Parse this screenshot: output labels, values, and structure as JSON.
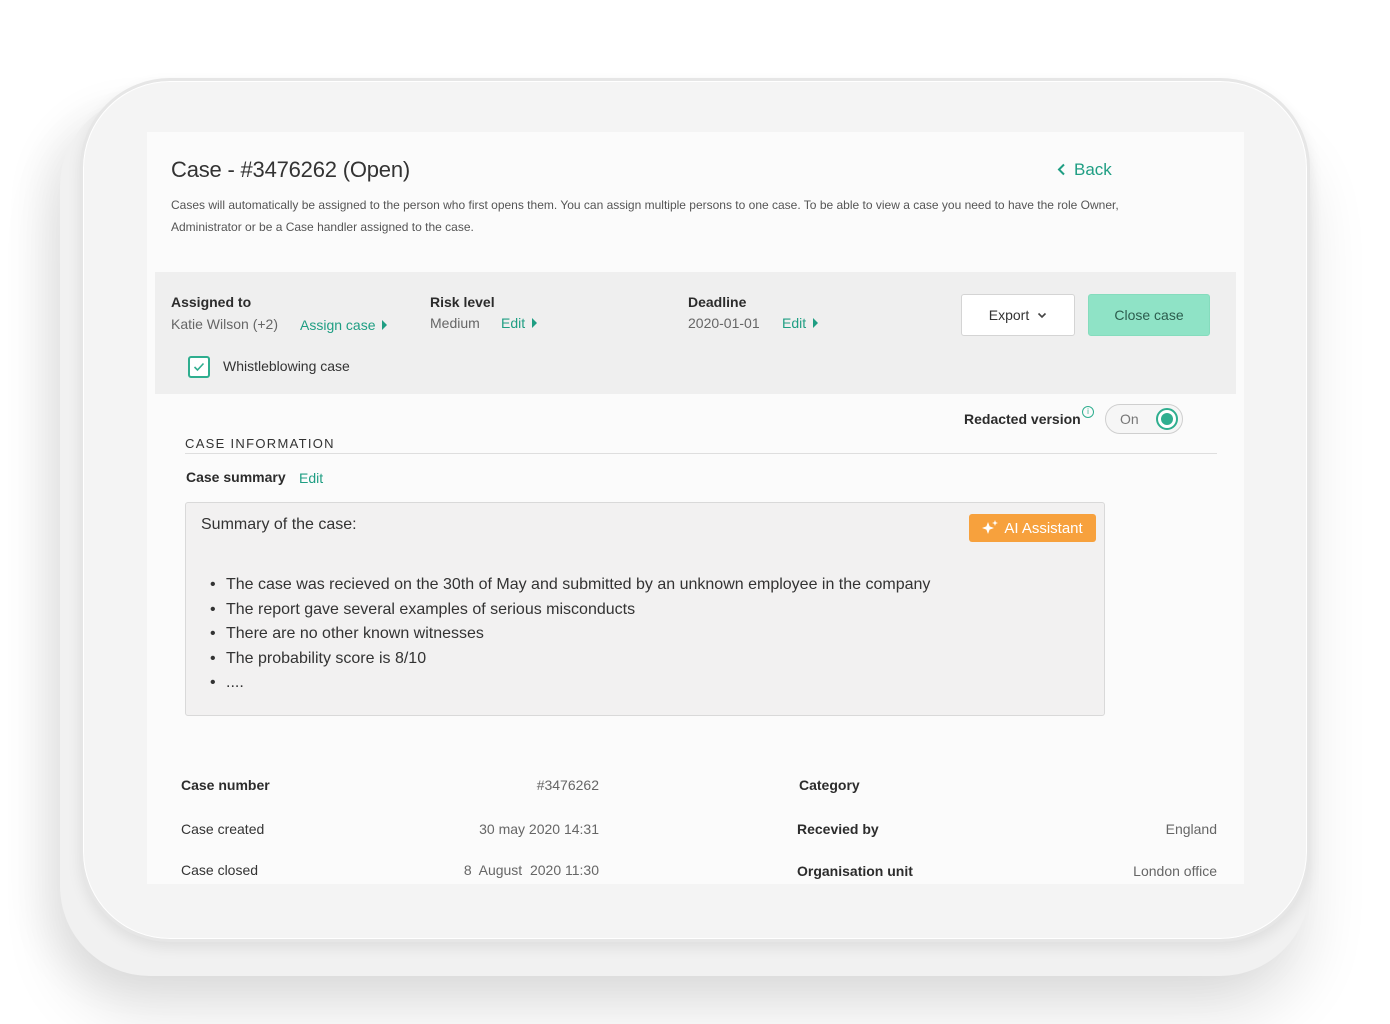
{
  "header": {
    "title": "Case - #3476262 (Open)",
    "back_label": "Back",
    "description": "Cases will automatically be assigned to the person who first opens them. You can assign multiple persons to one case. To be able to view a case you need to have the role Owner, Administrator or be a Case handler assigned to the case."
  },
  "bar": {
    "assigned_label": "Assigned to",
    "assigned_value": "Katie Wilson (+2)",
    "assign_link": "Assign case",
    "risk_label": "Risk level",
    "risk_value": "Medium",
    "risk_edit": "Edit",
    "deadline_label": "Deadline",
    "deadline_value": "2020-01-01",
    "deadline_edit": "Edit",
    "export_label": "Export",
    "close_label": "Close case",
    "whistle_label": "Whistleblowing case",
    "whistle_checked": true
  },
  "redacted": {
    "label": "Redacted version",
    "info": "i",
    "toggle_label": "On",
    "enabled": true
  },
  "info_section": {
    "heading": "CASE INFORMATION",
    "summary_label": "Case summary",
    "summary_edit": "Edit",
    "summary_title": "Summary of the case:",
    "ai_label": "AI Assistant",
    "bullets": [
      "The case was recieved on the 30th of May and submitted by an unknown employee in the company",
      "The report gave several examples of serious misconducts",
      "There are no other known witnesses",
      "The probability score is 8/10",
      "...."
    ]
  },
  "details": {
    "left": [
      {
        "label": "Case number",
        "value": "#3476262"
      },
      {
        "label": "Case created",
        "value": "30 may 2020 14:31"
      },
      {
        "label": "Case closed",
        "value": "8  August  2020 11:30"
      }
    ],
    "right": [
      {
        "label": "Category",
        "value": ""
      },
      {
        "label": "Recevied by",
        "value": "England"
      },
      {
        "label": "Organisation unit",
        "value": "London office"
      }
    ]
  },
  "colors": {
    "accent": "#1f9e83",
    "close_button": "#8fe3c6",
    "ai_button": "#f7a13d"
  }
}
